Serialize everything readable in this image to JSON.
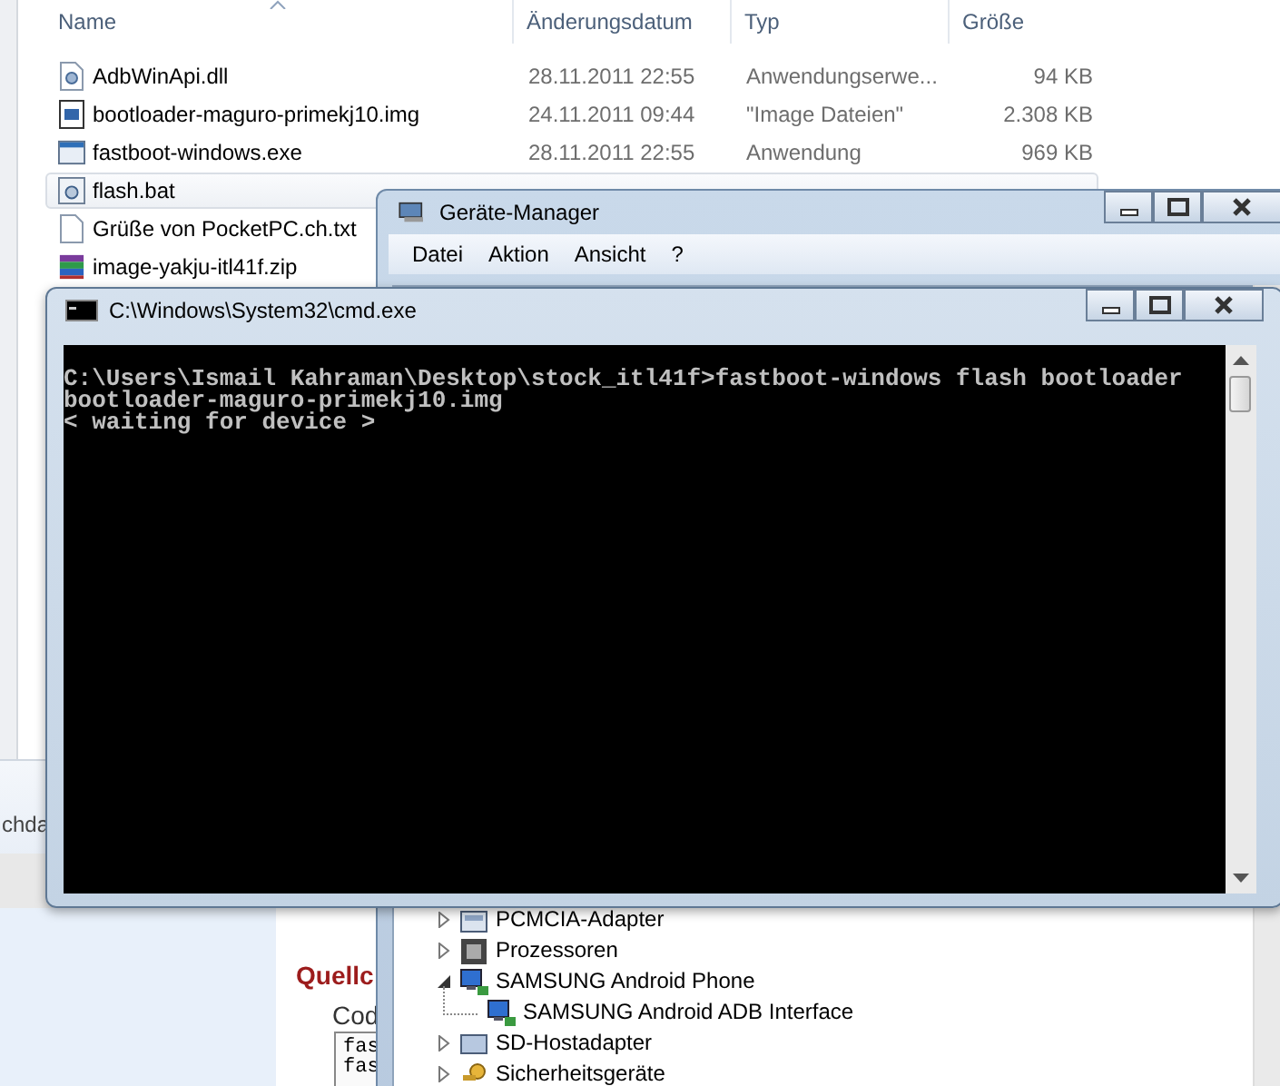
{
  "explorer": {
    "columns": [
      "Name",
      "Änderungsdatum",
      "Typ",
      "Größe"
    ],
    "files": [
      {
        "name": "AdbWinApi.dll",
        "date": "28.11.2011 22:55",
        "type": "Anwendungserwe...",
        "size": "94 KB",
        "kind": "dll",
        "highlighted": false
      },
      {
        "name": "bootloader-maguro-primekj10.img",
        "date": "24.11.2011 09:44",
        "type": "\"Image Dateien\"",
        "size": "2.308 KB",
        "kind": "img",
        "highlighted": false
      },
      {
        "name": "fastboot-windows.exe",
        "date": "28.11.2011 22:55",
        "type": "Anwendung",
        "size": "969 KB",
        "kind": "exe",
        "highlighted": false
      },
      {
        "name": "flash.bat",
        "kind": "bat",
        "highlighted": true
      },
      {
        "name": "Grüße von PocketPC.ch.txt",
        "kind": "txt",
        "highlighted": false
      },
      {
        "name": "image-yakju-itl41f.zip",
        "kind": "zip",
        "highlighted": false
      }
    ],
    "details_fragment": "chda"
  },
  "web_page": {
    "heading": "Quellc",
    "label": "Cod",
    "code_lines": [
      "fas",
      "fas"
    ]
  },
  "device_manager": {
    "title": "Geräte-Manager",
    "menu": [
      "Datei",
      "Aktion",
      "Ansicht",
      "?"
    ],
    "tree": [
      {
        "label": "PCMCIA-Adapter",
        "kind": "pcmcia",
        "expanded": false
      },
      {
        "label": "Prozessoren",
        "kind": "cpu",
        "expanded": false
      },
      {
        "label": "SAMSUNG Android Phone",
        "kind": "phone",
        "expanded": true,
        "children": [
          {
            "label": "SAMSUNG Android ADB Interface",
            "kind": "phone"
          }
        ]
      },
      {
        "label": "SD-Hostadapter",
        "kind": "sd",
        "expanded": false
      },
      {
        "label": "Sicherheitsgeräte",
        "kind": "key",
        "expanded": false
      }
    ]
  },
  "cmd": {
    "title": "C:\\Windows\\System32\\cmd.exe",
    "lines": [
      "C:\\Users\\Ismail Kahraman\\Desktop\\stock_itl41f>fastboot-windows flash bootloader",
      "bootloader-maguro-primekj10.img",
      "< waiting for device >"
    ]
  }
}
